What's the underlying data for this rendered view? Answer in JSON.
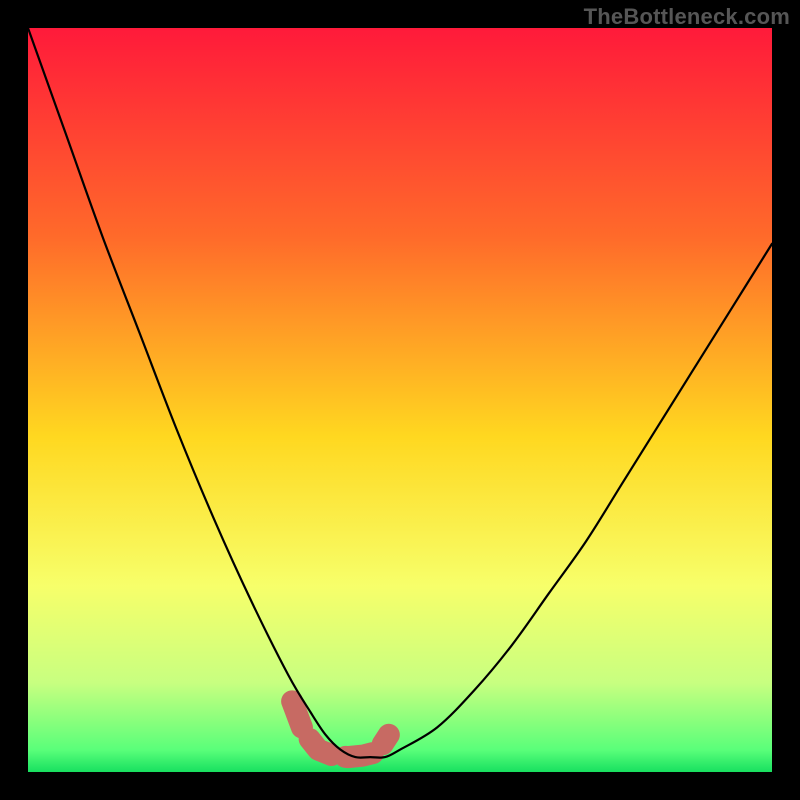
{
  "attribution": "TheBottleneck.com",
  "chart_data": {
    "type": "line",
    "title": "",
    "xlabel": "",
    "ylabel": "",
    "xlim": [
      0,
      100
    ],
    "ylim": [
      0,
      100
    ],
    "gradient_stops": [
      {
        "offset": 0,
        "color": "#ff1a3a"
      },
      {
        "offset": 0.28,
        "color": "#ff6a2a"
      },
      {
        "offset": 0.55,
        "color": "#ffd820"
      },
      {
        "offset": 0.75,
        "color": "#f7ff6a"
      },
      {
        "offset": 0.88,
        "color": "#c8ff80"
      },
      {
        "offset": 0.97,
        "color": "#5aff7a"
      },
      {
        "offset": 1.0,
        "color": "#18e060"
      }
    ],
    "series": [
      {
        "name": "bottleneck-curve",
        "x": [
          0,
          5,
          10,
          15,
          20,
          25,
          30,
          35,
          38,
          40,
          42,
          44,
          46,
          48,
          50,
          55,
          60,
          65,
          70,
          75,
          80,
          85,
          90,
          95,
          100
        ],
        "y": [
          100,
          86,
          72,
          59,
          46,
          34,
          23,
          13,
          8,
          5,
          3,
          2,
          2,
          2,
          3,
          6,
          11,
          17,
          24,
          31,
          39,
          47,
          55,
          63,
          71
        ]
      }
    ],
    "highlight_band": {
      "name": "optimal-range",
      "color": "#c76a63",
      "x": [
        35.5,
        37,
        39,
        41,
        43,
        45,
        47,
        48.5
      ],
      "y": [
        9.5,
        5.5,
        3.0,
        2.2,
        2.0,
        2.2,
        2.7,
        5.0
      ]
    }
  }
}
